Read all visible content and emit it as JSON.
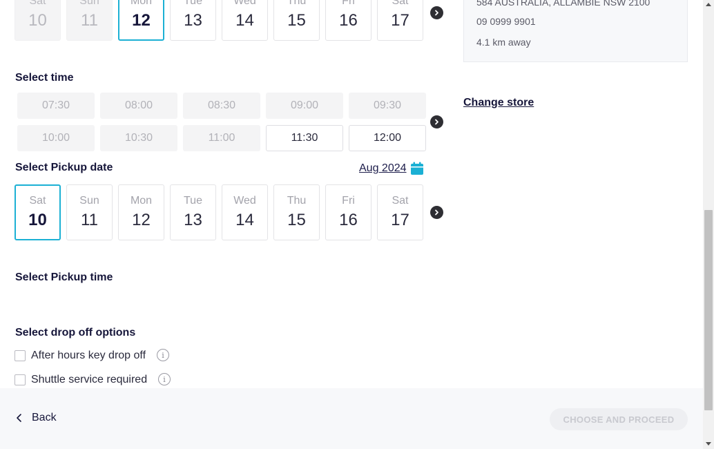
{
  "top_dates": [
    {
      "day": "Sat",
      "num": "10",
      "state": "disabled"
    },
    {
      "day": "Sun",
      "num": "11",
      "state": "disabled"
    },
    {
      "day": "Mon",
      "num": "12",
      "state": "selected"
    },
    {
      "day": "Tue",
      "num": "13",
      "state": "available"
    },
    {
      "day": "Wed",
      "num": "14",
      "state": "available"
    },
    {
      "day": "Thu",
      "num": "15",
      "state": "available"
    },
    {
      "day": "Fri",
      "num": "16",
      "state": "available"
    },
    {
      "day": "Sat",
      "num": "17",
      "state": "available"
    }
  ],
  "select_time": {
    "title": "Select time",
    "slots": [
      {
        "time": "07:30",
        "state": "disabled"
      },
      {
        "time": "08:00",
        "state": "disabled"
      },
      {
        "time": "08:30",
        "state": "disabled"
      },
      {
        "time": "09:00",
        "state": "disabled"
      },
      {
        "time": "09:30",
        "state": "disabled"
      },
      {
        "time": "10:00",
        "state": "disabled"
      },
      {
        "time": "10:30",
        "state": "disabled"
      },
      {
        "time": "11:00",
        "state": "disabled"
      },
      {
        "time": "11:30",
        "state": "available"
      },
      {
        "time": "12:00",
        "state": "available"
      }
    ]
  },
  "pickup_date": {
    "title": "Select Pickup date",
    "month": "Aug 2024",
    "dates": [
      {
        "day": "Sat",
        "num": "10",
        "state": "selected"
      },
      {
        "day": "Sun",
        "num": "11",
        "state": "available"
      },
      {
        "day": "Mon",
        "num": "12",
        "state": "available"
      },
      {
        "day": "Tue",
        "num": "13",
        "state": "available"
      },
      {
        "day": "Wed",
        "num": "14",
        "state": "available"
      },
      {
        "day": "Thu",
        "num": "15",
        "state": "available"
      },
      {
        "day": "Fri",
        "num": "16",
        "state": "available"
      },
      {
        "day": "Sat",
        "num": "17",
        "state": "available"
      }
    ]
  },
  "pickup_time": {
    "title": "Select Pickup time"
  },
  "drop_off": {
    "title": "Select drop off options",
    "options": [
      {
        "label": "After hours key drop off",
        "checked": false
      },
      {
        "label": "Shuttle service required",
        "checked": false
      }
    ]
  },
  "store": {
    "address": "584 AUSTRALIA, ALLAMBIE NSW 2100",
    "phone": "09 0999 9901",
    "distance": "4.1 km away",
    "change_label": "Change store"
  },
  "footer": {
    "back_label": "Back",
    "proceed_label": "CHOOSE AND PROCEED"
  },
  "colors": {
    "accent": "#1bb0d4",
    "navy": "#16163a",
    "calendar_icon": "#1bb0d4"
  },
  "icons": {
    "next_arrow": "chevron-circle-right-icon",
    "calendar": "calendar-icon",
    "info": "info-icon",
    "back": "chevron-left-icon"
  }
}
